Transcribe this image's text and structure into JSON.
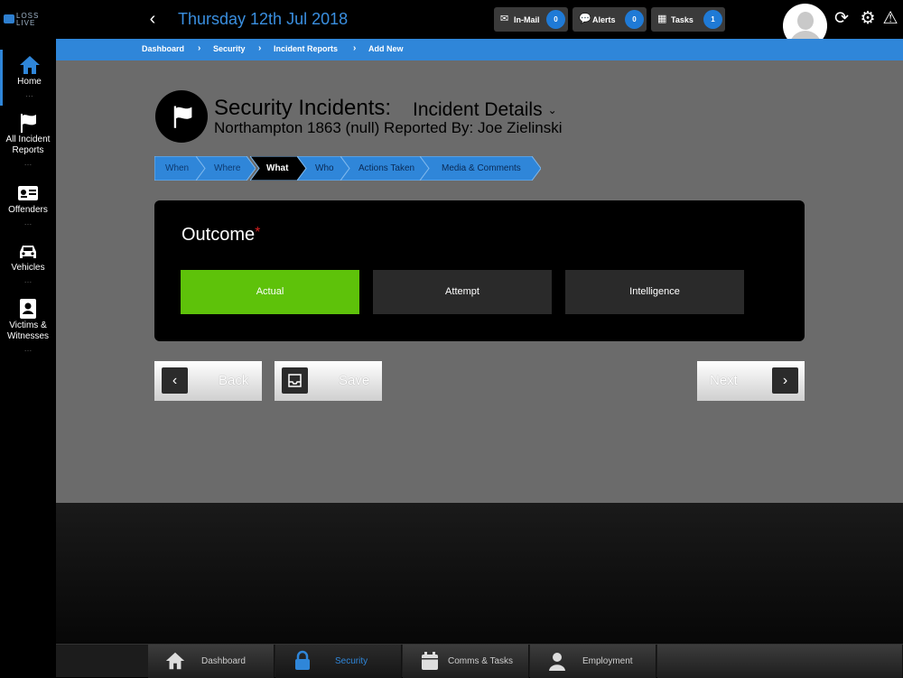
{
  "app": {
    "logo_text": "LOSS\nLIVE",
    "date_title": "Thursday 12th Jul 2018"
  },
  "header": {
    "pills": [
      {
        "icon": "mail-icon",
        "label": "In-Mail",
        "count": "0"
      },
      {
        "icon": "chat-icon",
        "label": "Alerts",
        "count": "0"
      },
      {
        "icon": "calendar-check-icon",
        "label": "Tasks",
        "count": "1"
      }
    ]
  },
  "breadcrumb": [
    "Dashboard",
    "Security",
    "Incident Reports",
    "Add New"
  ],
  "sidebar": {
    "items": [
      {
        "label": "Home",
        "icon": "home-icon"
      },
      {
        "label": "All Incident Reports",
        "icon": "flag-icon"
      },
      {
        "label": "Offenders",
        "icon": "id-card-icon"
      },
      {
        "label": "Vehicles",
        "icon": "car-icon"
      },
      {
        "label": "Victims & Witnesses",
        "icon": "address-book-icon"
      }
    ]
  },
  "page": {
    "title": "Security Incidents:",
    "subtitle": "Incident Details",
    "line2": "Northampton 1863 (null) Reported By: Joe Zielinski"
  },
  "steps": [
    {
      "label": "When",
      "state": "done"
    },
    {
      "label": "Where",
      "state": "done"
    },
    {
      "label": "What",
      "state": "current"
    },
    {
      "label": "Who",
      "state": "todo"
    },
    {
      "label": "Actions Taken",
      "state": "todo"
    },
    {
      "label": "Media & Comments",
      "state": "todo"
    }
  ],
  "outcome": {
    "title": "Outcome",
    "required_mark": "*",
    "options": [
      "Actual",
      "Attempt",
      "Intelligence"
    ],
    "selected": "Actual"
  },
  "buttons": {
    "back": "Back",
    "save": "Save",
    "next": "Next"
  },
  "bottom_tabs": [
    {
      "label": "Dashboard",
      "icon": "home-icon",
      "active": false
    },
    {
      "label": "Security",
      "icon": "lock-icon",
      "active": true
    },
    {
      "label": "Comms & Tasks",
      "icon": "calendar-icon",
      "active": false
    },
    {
      "label": "Employment",
      "icon": "user-icon",
      "active": false
    },
    {
      "label": "",
      "icon": "",
      "active": false
    }
  ],
  "colors": {
    "accent": "#2f86d9",
    "selected": "#5ec20a",
    "panel": "#6b6b6b"
  }
}
